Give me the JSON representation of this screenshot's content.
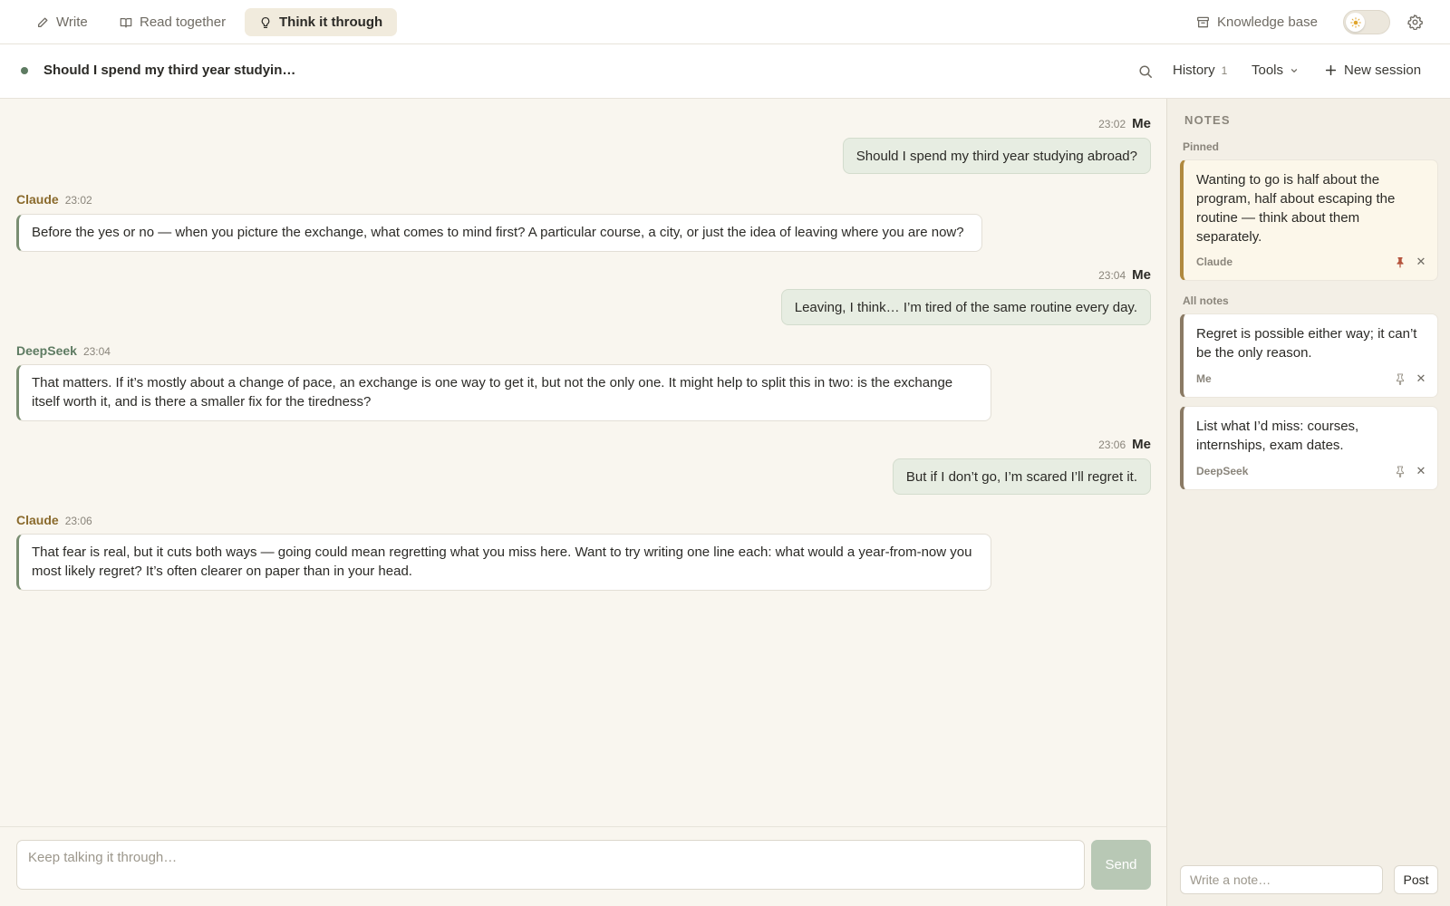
{
  "modes": {
    "write": {
      "label": "Write",
      "icon": "pencil-icon"
    },
    "read": {
      "label": "Read together",
      "icon": "book-icon"
    },
    "think": {
      "label": "Think it through",
      "icon": "lightbulb-icon",
      "active": true
    }
  },
  "topbar": {
    "knowledge_base": "Knowledge base",
    "knowledge_base_icon": "archive-icon",
    "theme_toggle_icon": "sun-icon",
    "settings_icon": "gear-icon"
  },
  "session": {
    "title": "Should I spend my third year studyin…",
    "status_color": "#5e7b62",
    "history_label": "History",
    "history_count": "1",
    "tools_label": "Tools",
    "new_session_label": "New session"
  },
  "messages": [
    {
      "role": "user",
      "sender": "Me",
      "time": "23:02",
      "text": "Should I spend my third year studying abroad?"
    },
    {
      "role": "assistant",
      "sender": "Claude",
      "time": "23:02",
      "text": "Before the yes or no — when you picture the exchange, what comes to mind first? A particular course, a city, or just the idea of leaving where you are now?"
    },
    {
      "role": "user",
      "sender": "Me",
      "time": "23:04",
      "text": "Leaving, I think… I’m tired of the same routine every day."
    },
    {
      "role": "assistant",
      "sender": "DeepSeek",
      "time": "23:04",
      "text": "That matters. If it’s mostly about a change of pace, an exchange is one way to get it, but not the only one. It might help to split this in two: is the exchange itself worth it, and is there a smaller fix for the tiredness?"
    },
    {
      "role": "user",
      "sender": "Me",
      "time": "23:06",
      "text": "But if I don’t go, I’m scared I’ll regret it."
    },
    {
      "role": "assistant",
      "sender": "Claude",
      "time": "23:06",
      "text": "That fear is real, but it cuts both ways — going could mean regretting what you miss here. Want to try writing one line each: what would a year-from-now you most likely regret? It’s often clearer on paper than in your head."
    }
  ],
  "composer": {
    "placeholder": "Keep talking it through…",
    "send_label": "Send"
  },
  "notes": {
    "heading": "NOTES",
    "pinned_label": "Pinned",
    "all_label": "All notes",
    "pinned": [
      {
        "text": "Wanting to go is half about the program, half about escaping the routine — think about them separately.",
        "author": "Claude"
      }
    ],
    "all": [
      {
        "text": "Regret is possible either way; it can’t be the only reason.",
        "author": "Me"
      },
      {
        "text": "List what I’d miss: courses, internships, exam dates.",
        "author": "DeepSeek"
      }
    ],
    "input_placeholder": "Write a note…",
    "post_label": "Post"
  },
  "colors": {
    "accent_green": "#5e7b62",
    "claude_brown": "#8a6a2c",
    "user_bubble": "#e7ede2",
    "pin_red": "#b5533c"
  }
}
